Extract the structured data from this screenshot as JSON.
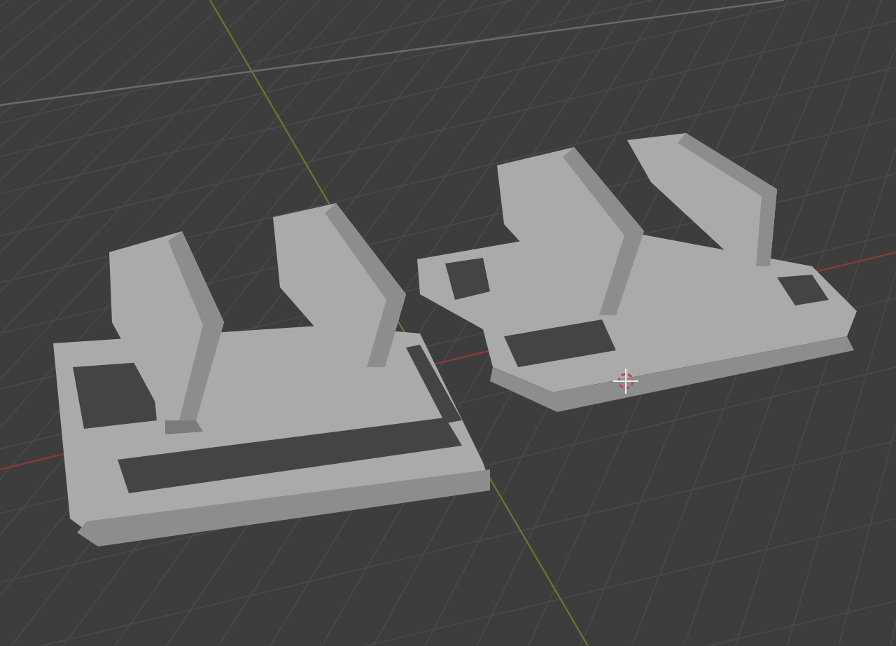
{
  "viewport": {
    "grid": true,
    "axes": true,
    "cursor": true
  }
}
